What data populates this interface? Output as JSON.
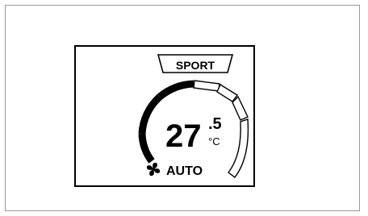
{
  "display": {
    "mode_label": "SPORT",
    "temperature": {
      "integer": "27",
      "decimal": ".5",
      "unit": "°C"
    },
    "fan_mode_label": "AUTO",
    "fan_icon": "fan-icon",
    "arc_gauge": {
      "segments_total": 7,
      "segments_filled": 3,
      "segments_empty": 4
    }
  },
  "colors": {
    "ink": "#000000",
    "background": "#ffffff",
    "frame_border": "#9a9a9a"
  }
}
